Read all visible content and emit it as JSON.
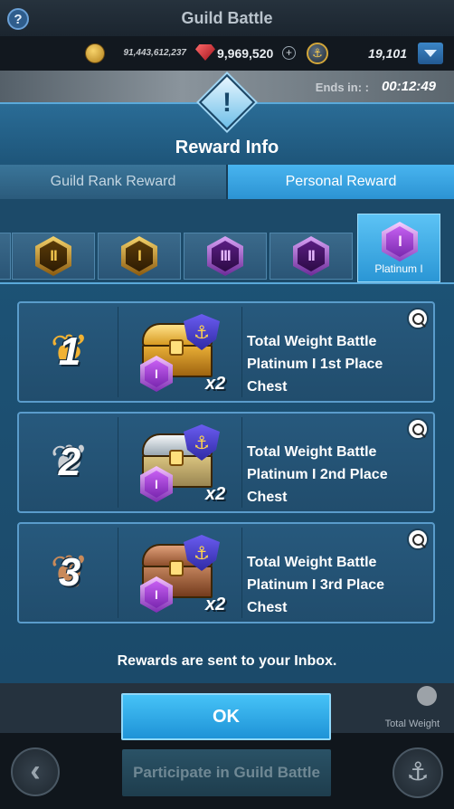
{
  "header": {
    "title": "Guild Battle",
    "help_icon": "help-icon",
    "help_glyph": "?"
  },
  "currency": {
    "gold": "91,443,612,237",
    "gems": "9,969,520",
    "plus_glyph": "+",
    "anchors": "19,101"
  },
  "timer": {
    "label": "Ends in: :",
    "value": "00:12:49"
  },
  "modal": {
    "badge_glyph": "!",
    "title": "Reward Info",
    "tabs": [
      {
        "label": "Guild Rank Reward",
        "active": false
      },
      {
        "label": "Personal Reward",
        "active": true
      }
    ],
    "tiers": [
      {
        "glyph": "II",
        "color": "gold"
      },
      {
        "glyph": "I",
        "color": "gold"
      },
      {
        "glyph": "III",
        "color": "purple"
      },
      {
        "glyph": "II",
        "color": "purple"
      },
      {
        "glyph": "I",
        "color": "platinum",
        "label": "Platinum I",
        "selected": true
      }
    ],
    "rewards": [
      {
        "rank": "1",
        "name": "Total Weight Battle\nPlatinum I 1st Place\nChest",
        "quantity": "x2",
        "chest": "gold",
        "laurel_color": "#f2b233"
      },
      {
        "rank": "2",
        "name": "Total Weight Battle\nPlatinum I 2nd Place\nChest",
        "quantity": "x2",
        "chest": "silver",
        "laurel_color": "#c9ced3"
      },
      {
        "rank": "3",
        "name": "Total Weight Battle\nPlatinum I 3rd Place\nChest",
        "quantity": "x2",
        "chest": "bronze",
        "laurel_color": "#c98a5a"
      }
    ],
    "shield_glyph": "⚓",
    "hex_glyph": "I",
    "laurel_glyph": "❦",
    "note": "Rewards are sent to your Inbox.",
    "ok_label": "OK"
  },
  "background": {
    "row_label": "Total Weight",
    "participate_label": "Participate in Guild Battle",
    "back_glyph": "‹",
    "anchor_glyph": "⚓"
  },
  "colors": {
    "accent": "#2c93d3",
    "modal_bg": "#1d5478",
    "gold": "#f2b233"
  }
}
